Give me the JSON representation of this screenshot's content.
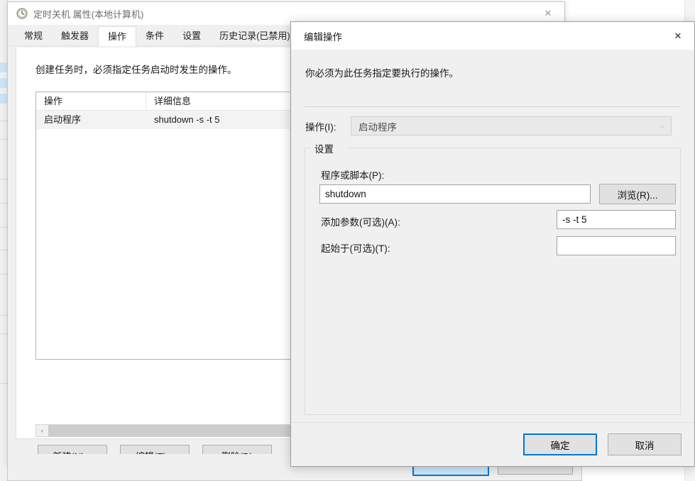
{
  "background_window": {
    "title": "定时关机 属性(本地计算机)",
    "title_icon": "clock-icon",
    "close_label": "✕",
    "tabs": [
      {
        "label": "常规",
        "active": false
      },
      {
        "label": "触发器",
        "active": false
      },
      {
        "label": "操作",
        "active": true
      },
      {
        "label": "条件",
        "active": false
      },
      {
        "label": "设置",
        "active": false
      },
      {
        "label": "历史记录(已禁用)",
        "active": false
      }
    ],
    "intro_text": "创建任务时，必须指定任务启动时发生的操作。",
    "actions_table": {
      "columns": [
        "操作",
        "详细信息",
        ""
      ],
      "rows": [
        {
          "action": "启动程序",
          "details": "shutdown -s -t 5",
          "extra": ""
        }
      ]
    },
    "scrollbar": {
      "left_arrow": "‹"
    },
    "buttons": [
      {
        "label": "新建(N)..."
      },
      {
        "label": "编辑(E)..."
      },
      {
        "label": "删除(D)"
      }
    ]
  },
  "dialog": {
    "title": "编辑操作",
    "close_label": "✕",
    "description": "你必须为此任务指定要执行的操作。",
    "action_field": {
      "label": "操作(I):",
      "value": "启动程序",
      "arrow": "⌄"
    },
    "settings_group": {
      "legend": "设置",
      "program_label": "程序或脚本(P):",
      "program_value": "shutdown",
      "program_placeholder": "",
      "browse_label": "浏览(R)...",
      "arguments_label": "添加参数(可选)(A):",
      "arguments_value": "-s -t 5",
      "arguments_placeholder": "",
      "startin_label": "起始于(可选)(T):",
      "startin_value": "",
      "startin_placeholder": ""
    },
    "footer": {
      "ok_label": "确定",
      "cancel_label": "取消"
    }
  },
  "colors": {
    "accent": "#0078d7",
    "window_bg": "#f0f0f0",
    "field_bg": "#ffffff",
    "disabled_field_bg": "#e9e9e9",
    "button_bg": "#e1e1e1",
    "selected_row_bg": "#f3f3f3"
  }
}
